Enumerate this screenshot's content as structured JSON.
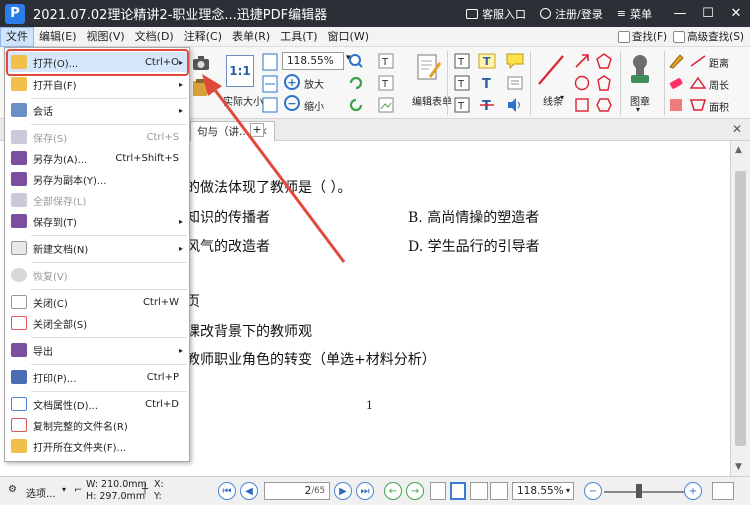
{
  "titlebar": {
    "logo": "P",
    "title": "2021.07.02理论精讲2-职业理念...迅捷PDF编辑器",
    "service": "客服入口",
    "login": "注册/登录",
    "menu": "菜单"
  },
  "menubar": {
    "items": [
      "文件",
      "编辑(E)",
      "视图(V)",
      "文档(D)",
      "注释(C)",
      "表单(R)",
      "工具(T)",
      "窗口(W)"
    ],
    "find": "查找(F)",
    "advanced_find": "高级查找(S)"
  },
  "ribbon": {
    "zoom_value": "118.55%",
    "actual_size": "实际大小",
    "zoom_in": "放大",
    "zoom_out": "缩小",
    "edit_form": "编辑表单",
    "line": "线条",
    "stamp": "图章",
    "distance": "距离",
    "perimeter": "周长",
    "area": "面积"
  },
  "doc_tab": {
    "label": "句与（讲..."
  },
  "document": {
    "lines": [
      "的做法体现了教师是（    ）。",
      "知识的传播者",
      "B. 高尚情操的塑造者",
      "风气的改造者",
      "D. 学生品行的引导者",
      "页",
      "课改背景下的教师观",
      "教师职业角色的转变（单选+材料分析）"
    ],
    "page_number": "1"
  },
  "statusbar": {
    "options": "选项...",
    "width": "W: 210.0mm",
    "height": "H: 297.0mm",
    "x_label": "X:",
    "y_label": "Y:",
    "current_page": "2",
    "total_pages": "/65",
    "zoom_value": "118.55%"
  },
  "file_menu": {
    "items": [
      {
        "label": "打开(O)...",
        "shortcut": "Ctrl+O",
        "arrow": "▸"
      },
      {
        "label": "打开自(F)",
        "shortcut": "",
        "arrow": "▸"
      },
      {
        "label": "会话",
        "shortcut": "",
        "arrow": "▸"
      },
      {
        "label": "保存(S)",
        "shortcut": "Ctrl+S",
        "arrow": ""
      },
      {
        "label": "另存为(A)...",
        "shortcut": "Ctrl+Shift+S",
        "arrow": ""
      },
      {
        "label": "另存为副本(Y)...",
        "shortcut": "",
        "arrow": ""
      },
      {
        "label": "全部保存(L)",
        "shortcut": "",
        "arrow": ""
      },
      {
        "label": "保存到(T)",
        "shortcut": "",
        "arrow": "▸"
      },
      {
        "label": "新建文档(N)",
        "shortcut": "",
        "arrow": "▸"
      },
      {
        "label": "恢复(V)",
        "shortcut": "",
        "arrow": ""
      },
      {
        "label": "关闭(C)",
        "shortcut": "Ctrl+W",
        "arrow": ""
      },
      {
        "label": "关闭全部(S)",
        "shortcut": "",
        "arrow": ""
      },
      {
        "label": "导出",
        "shortcut": "",
        "arrow": "▸"
      },
      {
        "label": "打印(P)...",
        "shortcut": "Ctrl+P",
        "arrow": ""
      },
      {
        "label": "文档属性(D)...",
        "shortcut": "Ctrl+D",
        "arrow": ""
      },
      {
        "label": "复制完整的文件名(R)",
        "shortcut": "",
        "arrow": ""
      },
      {
        "label": "打开所在文件夹(F)...",
        "shortcut": "",
        "arrow": ""
      }
    ]
  },
  "colors": {
    "titlebar_bg": "#2b2f36",
    "accent_blue": "#2d73c9",
    "highlight_red": "#e04a3a",
    "menu_active_bg": "#cfe3fb"
  }
}
